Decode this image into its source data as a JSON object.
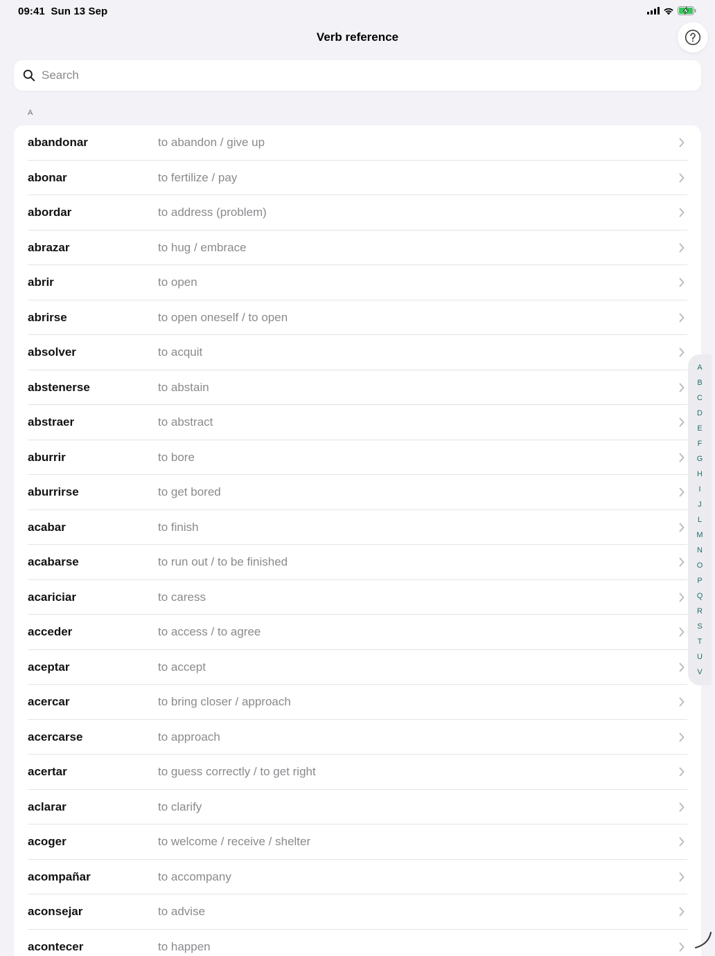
{
  "status_bar": {
    "time": "09:41",
    "date": "Sun 13 Sep",
    "icons": [
      "cellular-signal-icon",
      "wifi-icon",
      "battery-charging-icon"
    ]
  },
  "nav": {
    "title": "Verb reference",
    "help_icon": "question-circle-icon"
  },
  "search": {
    "placeholder": "Search",
    "value": "",
    "icon": "magnifying-glass-icon"
  },
  "section": {
    "header": "A"
  },
  "verbs": [
    {
      "verb": "abandonar",
      "meaning": "to abandon / give up"
    },
    {
      "verb": "abonar",
      "meaning": "to fertilize / pay"
    },
    {
      "verb": "abordar",
      "meaning": "to address (problem)"
    },
    {
      "verb": "abrazar",
      "meaning": "to hug / embrace"
    },
    {
      "verb": "abrir",
      "meaning": "to open"
    },
    {
      "verb": "abrirse",
      "meaning": "to open oneself / to open"
    },
    {
      "verb": "absolver",
      "meaning": "to acquit"
    },
    {
      "verb": "abstenerse",
      "meaning": "to abstain"
    },
    {
      "verb": "abstraer",
      "meaning": "to abstract"
    },
    {
      "verb": "aburrir",
      "meaning": "to bore"
    },
    {
      "verb": "aburrirse",
      "meaning": "to get bored"
    },
    {
      "verb": "acabar",
      "meaning": "to finish"
    },
    {
      "verb": "acabarse",
      "meaning": "to run out / to be finished"
    },
    {
      "verb": "acariciar",
      "meaning": "to caress"
    },
    {
      "verb": "acceder",
      "meaning": "to access / to agree"
    },
    {
      "verb": "aceptar",
      "meaning": "to accept"
    },
    {
      "verb": "acercar",
      "meaning": "to bring closer / approach"
    },
    {
      "verb": "acercarse",
      "meaning": "to approach"
    },
    {
      "verb": "acertar",
      "meaning": "to guess correctly / to get right"
    },
    {
      "verb": "aclarar",
      "meaning": "to clarify"
    },
    {
      "verb": "acoger",
      "meaning": "to welcome / receive / shelter"
    },
    {
      "verb": "acompañar",
      "meaning": "to accompany"
    },
    {
      "verb": "aconsejar",
      "meaning": "to advise"
    },
    {
      "verb": "acontecer",
      "meaning": "to happen"
    }
  ],
  "index_letters": [
    "A",
    "B",
    "C",
    "D",
    "E",
    "F",
    "G",
    "H",
    "I",
    "J",
    "L",
    "M",
    "N",
    "O",
    "P",
    "Q",
    "R",
    "S",
    "T",
    "U",
    "V"
  ],
  "colors": {
    "background": "#f2f2f7",
    "accent": "#1f6e6a",
    "secondary_text": "#8a8a8e",
    "battery_green": "#34c759"
  }
}
